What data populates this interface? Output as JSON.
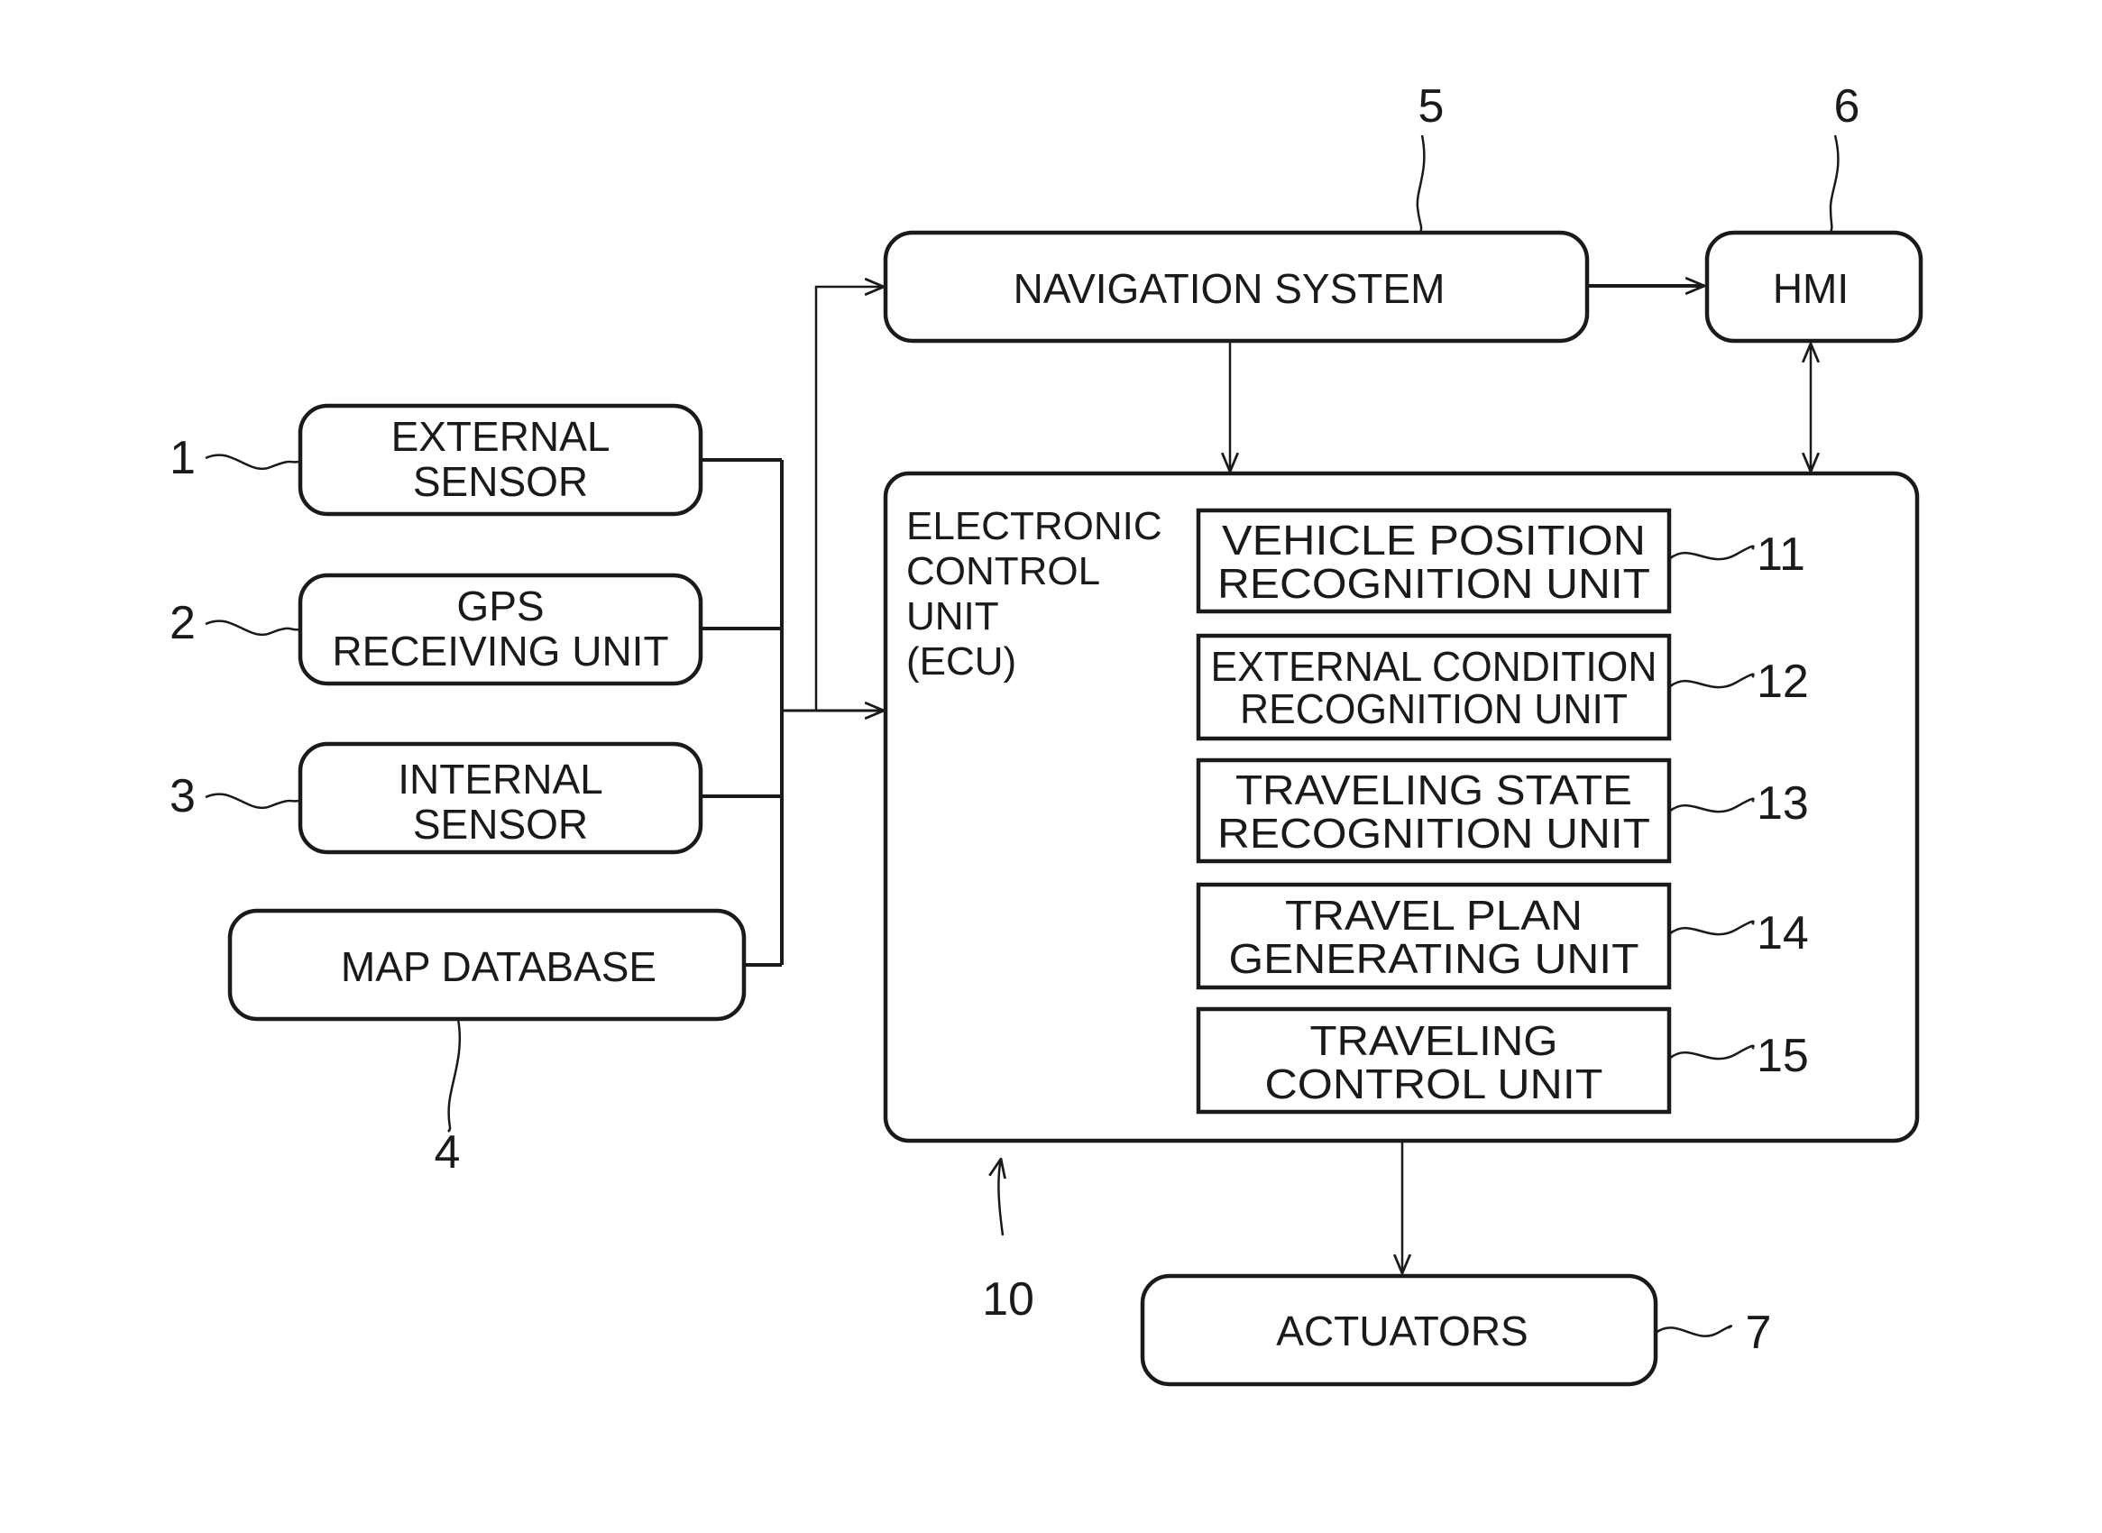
{
  "figure": {
    "blocks": {
      "external_sensor": {
        "ref": "1",
        "lines": [
          "EXTERNAL",
          "SENSOR"
        ]
      },
      "gps_receiving_unit": {
        "ref": "2",
        "lines": [
          "GPS",
          "RECEIVING UNIT"
        ]
      },
      "internal_sensor": {
        "ref": "3",
        "lines": [
          "INTERNAL",
          "SENSOR"
        ]
      },
      "map_database": {
        "ref": "4",
        "lines": [
          "MAP DATABASE"
        ]
      },
      "navigation_system": {
        "ref": "5",
        "lines": [
          "NAVIGATION SYSTEM"
        ]
      },
      "hmi": {
        "ref": "6",
        "lines": [
          "HMI"
        ]
      },
      "actuators": {
        "ref": "7",
        "lines": [
          "ACTUATORS"
        ]
      },
      "ecu": {
        "ref": "10",
        "lines": [
          "ELECTRONIC",
          "CONTROL",
          "UNIT",
          "(ECU)"
        ]
      }
    },
    "ecu_units": [
      {
        "ref": "11",
        "lines": [
          "VEHICLE POSITION",
          "RECOGNITION UNIT"
        ]
      },
      {
        "ref": "12",
        "lines": [
          "EXTERNAL CONDITION",
          "RECOGNITION UNIT"
        ]
      },
      {
        "ref": "13",
        "lines": [
          "TRAVELING STATE",
          "RECOGNITION UNIT"
        ]
      },
      {
        "ref": "14",
        "lines": [
          "TRAVEL PLAN",
          "GENERATING UNIT"
        ]
      },
      {
        "ref": "15",
        "lines": [
          "TRAVELING",
          "CONTROL UNIT"
        ]
      }
    ],
    "connections": [
      {
        "from": "external_sensor",
        "to": "bus"
      },
      {
        "from": "gps_receiving_unit",
        "to": "bus"
      },
      {
        "from": "internal_sensor",
        "to": "bus"
      },
      {
        "from": "map_database",
        "to": "bus"
      },
      {
        "from": "bus",
        "to": "navigation_system"
      },
      {
        "from": "bus",
        "to": "ecu"
      },
      {
        "from": "navigation_system",
        "to": "hmi"
      },
      {
        "from": "navigation_system",
        "to": "ecu"
      },
      {
        "from": "hmi",
        "to": "ecu",
        "bidirectional": true
      },
      {
        "from": "ecu",
        "to": "actuators"
      }
    ]
  }
}
